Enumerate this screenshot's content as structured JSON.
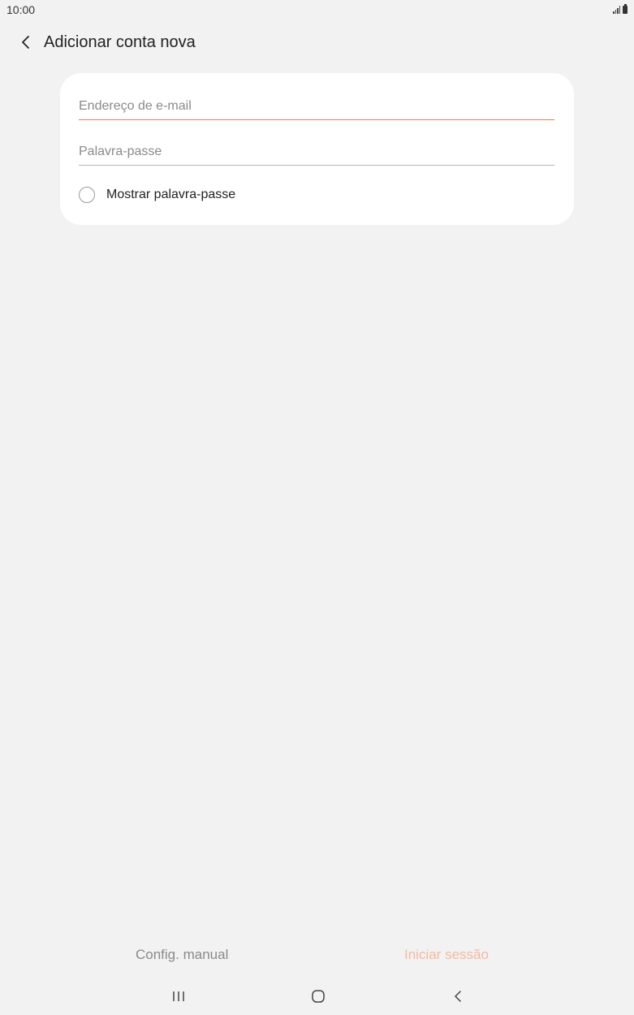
{
  "status_bar": {
    "time": "10:00"
  },
  "app_bar": {
    "back_icon": "chevron-left-icon",
    "title": "Adicionar conta nova"
  },
  "form": {
    "email": {
      "placeholder": "Endereço de e-mail",
      "value": "",
      "focused": true
    },
    "password": {
      "placeholder": "Palavra-passe",
      "value": ""
    },
    "show_password": {
      "label": "Mostrar palavra-passe",
      "checked": false
    }
  },
  "actions": {
    "manual_setup": "Config. manual",
    "sign_in": "Iniciar sessão"
  },
  "nav_bar": {
    "recent_icon": "recent-apps-icon",
    "home_icon": "home-icon",
    "back_icon": "back-icon"
  },
  "colors": {
    "background": "#f2f2f2",
    "card": "#ffffff",
    "accent": "#f07a52",
    "disabled_accent": "#f6b8a2",
    "muted_text": "#8a8a8a"
  }
}
